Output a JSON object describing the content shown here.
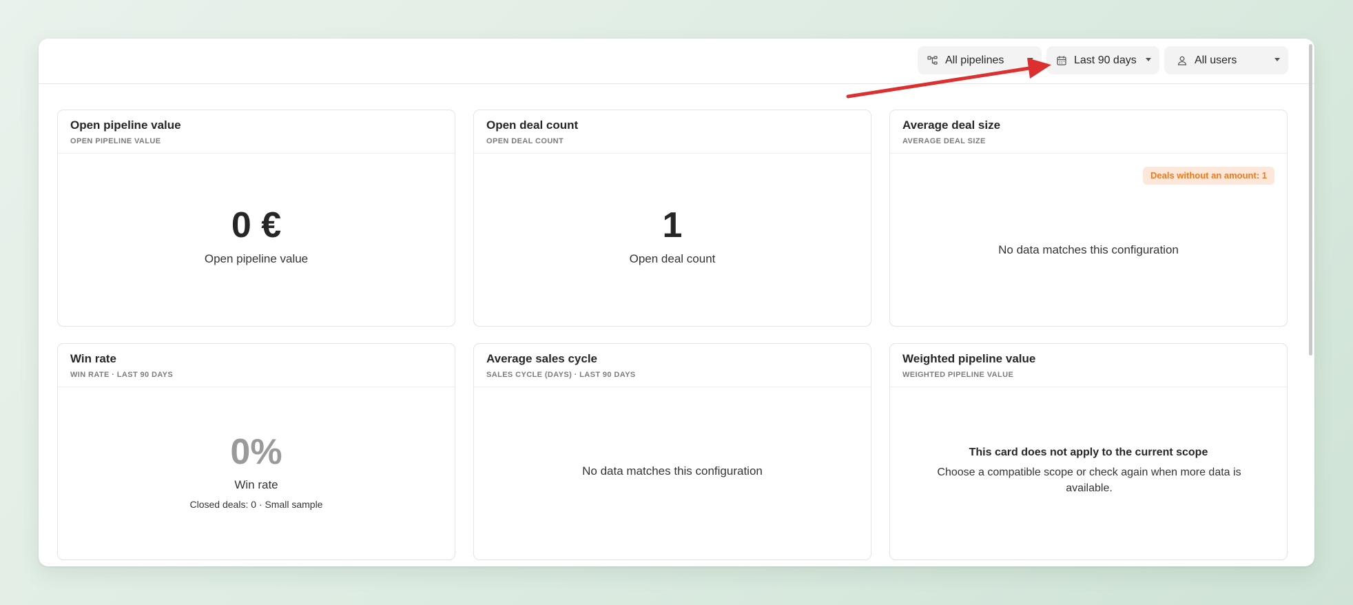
{
  "filters": {
    "pipelines": {
      "label": "All pipelines",
      "icon": "pipeline-icon"
    },
    "period": {
      "label": "Last 90 days",
      "icon": "calendar-icon"
    },
    "users": {
      "label": "All users",
      "icon": "user-icon"
    }
  },
  "cards": {
    "open_pipeline_value": {
      "title": "Open pipeline value",
      "subtitle": "OPEN PIPELINE VALUE",
      "value": "0 €",
      "label": "Open pipeline value"
    },
    "open_deal_count": {
      "title": "Open deal count",
      "subtitle": "OPEN DEAL COUNT",
      "value": "1",
      "label": "Open deal count"
    },
    "average_deal_size": {
      "title": "Average deal size",
      "subtitle": "AVERAGE DEAL SIZE",
      "badge": "Deals without an amount: 1",
      "empty_message": "No data matches this configuration"
    },
    "win_rate": {
      "title": "Win rate",
      "subtitle": "WIN RATE · LAST 90 DAYS",
      "value": "0%",
      "label": "Win rate",
      "note": "Closed deals: 0 · Small sample"
    },
    "average_sales_cycle": {
      "title": "Average sales cycle",
      "subtitle": "SALES CYCLE (DAYS) · LAST 90 DAYS",
      "empty_message": "No data matches this configuration"
    },
    "weighted_pipeline_value": {
      "title": "Weighted pipeline value",
      "subtitle": "WEIGHTED PIPELINE VALUE",
      "notice_title": "This card does not apply to the current scope",
      "notice_text": "Choose a compatible scope or check again when more data is available."
    }
  },
  "colors": {
    "accent_arrow": "#dc3030",
    "badge_bg": "#fde7da",
    "badge_text": "#f07a1a",
    "muted_value": "#9a9a9a"
  }
}
